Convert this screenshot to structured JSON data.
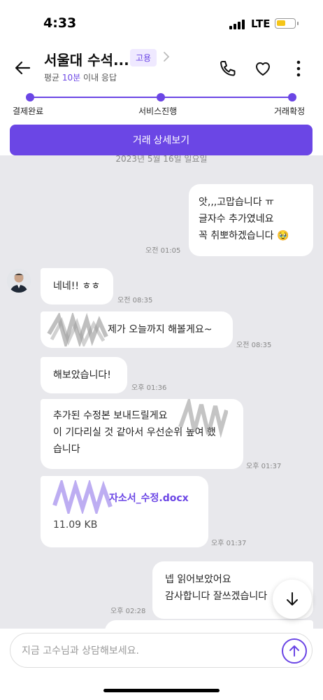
{
  "status_bar": {
    "time": "4:33",
    "network": "LTE",
    "battery_level": 0.4
  },
  "header": {
    "title": "서울대 수석...",
    "badge": "고용",
    "response_prefix": "평균 ",
    "response_highlight": "10분",
    "response_suffix": " 이내 응답",
    "icons": [
      "back-arrow-icon",
      "chevron-right-icon",
      "phone-icon",
      "heart-icon",
      "more-vertical-icon"
    ]
  },
  "progress": {
    "steps": [
      "결제완료",
      "서비스진행",
      "거래확정"
    ]
  },
  "detail_button": "거래 상세보기",
  "chat": {
    "date_divider": "2023년 5월 16일 일요일",
    "messages": [
      {
        "from": "me",
        "lines": [
          "앗,,,고맙습니다 ㅠ",
          "글자수 추가였네요",
          "꼭 취뽀하겠습니다 🥹"
        ],
        "time": "오전 01:05"
      },
      {
        "from": "them",
        "text": "네네!! ㅎㅎ",
        "time": "오전 08:35"
      },
      {
        "from": "them",
        "text": "제가 오늘까지 해볼게요~",
        "time": "오전 08:35"
      },
      {
        "from": "them",
        "text": "해보았습니다!",
        "time": "오후 01:36"
      },
      {
        "from": "them",
        "lines": [
          "추가된 수정본 보내드릴게요",
          "이 기다리실 것 같아서 우선순위 높여 했",
          "습니다"
        ],
        "time": "오후 01:37"
      },
      {
        "from": "them",
        "file_name": "자소서_수정.docx",
        "file_size": "11.09 KB",
        "time": "오후 01:37"
      },
      {
        "from": "me",
        "lines": [
          "넵 읽어보았어요",
          "감사합니다 잘쓰겠습니다"
        ],
        "time": "오후 02:28"
      }
    ]
  },
  "input": {
    "placeholder": "지금 고수님과 상담해보세요."
  },
  "colors": {
    "accent": "#6b46e5",
    "chat_bg": "#e8e8ec",
    "bubble": "#ffffff"
  }
}
